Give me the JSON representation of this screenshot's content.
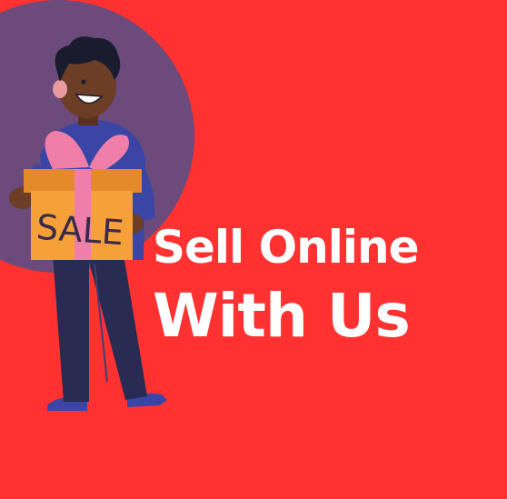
{
  "banner": {
    "headline_line1": "Sell Online",
    "headline_line2": "With Us",
    "box_label": "SALE"
  },
  "colors": {
    "background": "#ff3131",
    "circle": "#6c4a7b",
    "text": "#ffffff",
    "box": "#f6a03a",
    "ribbon": "#ef7fa8",
    "shirt": "#3b45a6",
    "pants": "#282b52",
    "skin": "#6b3e25",
    "hair": "#1b1b2e"
  }
}
